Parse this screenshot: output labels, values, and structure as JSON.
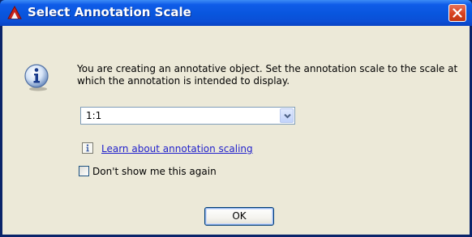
{
  "window": {
    "title": "Select Annotation Scale",
    "app_icon": "autocad-logo-icon",
    "close_icon": "close-icon"
  },
  "dialog": {
    "icon": "info-icon",
    "message": "You are creating an annotative object.  Set the annotation scale to the scale at which the annotation is intended to display.",
    "scale_select": {
      "selected": "1:1",
      "arrow_icon": "chevron-down-icon"
    },
    "learn_link": {
      "icon": "info-small-icon",
      "label": "Learn about annotation scaling"
    },
    "dont_show": {
      "label": "Don't show me this again",
      "checked": false
    },
    "ok_label": "OK"
  },
  "colors": {
    "titlebar": "#0855dd",
    "close_button": "#d8411f",
    "dialog_bg": "#ece9d8",
    "link": "#2222cc"
  }
}
